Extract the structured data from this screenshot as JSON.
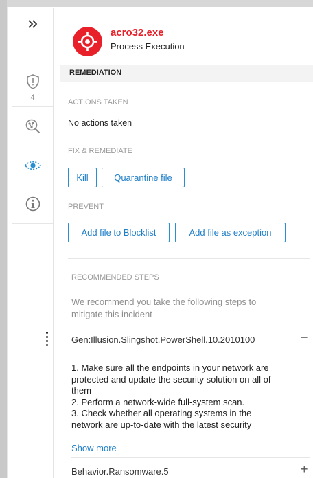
{
  "rail": {
    "collapse_icon": "double-chevron-right-icon",
    "items": [
      {
        "name": "shield-icon",
        "badge": "4"
      },
      {
        "name": "search-process-icon"
      },
      {
        "name": "eye-icon",
        "active": true
      },
      {
        "name": "info-icon"
      }
    ]
  },
  "header": {
    "title": "acro32.exe",
    "subtitle": "Process Execution",
    "icon": "target-icon",
    "accent": "#e8202a"
  },
  "remediation": {
    "section_title": "REMEDIATION",
    "actions_label": "ACTIONS TAKEN",
    "actions_text": "No actions taken",
    "fix_label": "FIX & REMEDIATE",
    "kill_button": "Kill",
    "quarantine_button": "Quarantine file",
    "prevent_label": "PREVENT",
    "blocklist_button": "Add file to Blocklist",
    "exception_button": "Add file as exception"
  },
  "recommended": {
    "label": "RECOMMENDED STEPS",
    "intro_line1": "We recommend you take the following steps to",
    "intro_line2": "mitigate this incident",
    "threats": [
      {
        "name": "Gen:Illusion.Slingshot.PowerShell.10.2010100",
        "toggle": "−",
        "steps": [
          "1. Make sure all the endpoints in your network are",
          "protected and update the security solution on all of",
          "them",
          "2. Perform a network-wide full-system scan.",
          "3. Check whether all operating systems in the",
          "network are up-to-date with the latest security"
        ],
        "show_more": "Show more"
      },
      {
        "name": "Behavior.Ransomware.5",
        "toggle": "+"
      }
    ]
  },
  "colors": {
    "link": "#1f7fc8",
    "muted": "#9a9a9a"
  }
}
